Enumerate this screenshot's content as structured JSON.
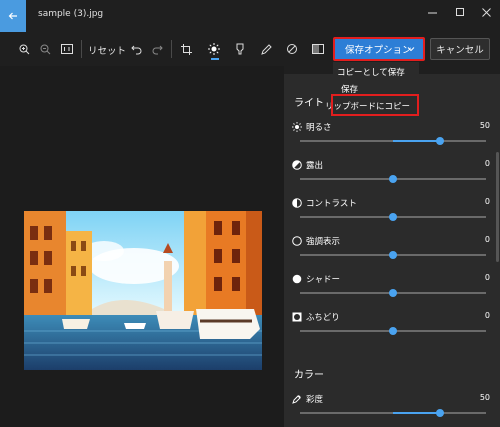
{
  "window": {
    "title": "sample (3).jpg"
  },
  "toolbar": {
    "reset_label": "リセット",
    "save_options_label": "保存オプション",
    "cancel_label": "キャンセル"
  },
  "save_menu": {
    "items": [
      "コピーとして保存",
      "保存",
      "リップボードにコピー"
    ]
  },
  "panel": {
    "light_section": "ライト",
    "color_section": "カラー",
    "adjustments": [
      {
        "label": "明るさ",
        "value": "50",
        "level": 0.75,
        "icon": "brightness-icon"
      },
      {
        "label": "露出",
        "value": "0",
        "level": 0.5,
        "icon": "exposure-icon"
      },
      {
        "label": "コントラスト",
        "value": "0",
        "level": 0.5,
        "icon": "contrast-icon"
      },
      {
        "label": "強調表示",
        "value": "0",
        "level": 0.5,
        "icon": "highlights-icon"
      },
      {
        "label": "シャドー",
        "value": "0",
        "level": 0.5,
        "icon": "shadows-icon"
      },
      {
        "label": "ふちどり",
        "value": "0",
        "level": 0.5,
        "icon": "vignette-icon"
      }
    ],
    "color_adjustments": [
      {
        "label": "彩度",
        "value": "50",
        "level": 0.75,
        "icon": "saturation-icon"
      }
    ]
  },
  "colors": {
    "accent": "#4aa3f0",
    "save_button": "#2d7ed6",
    "highlight_border": "#e21e1e",
    "back_button": "#4a9be0"
  }
}
